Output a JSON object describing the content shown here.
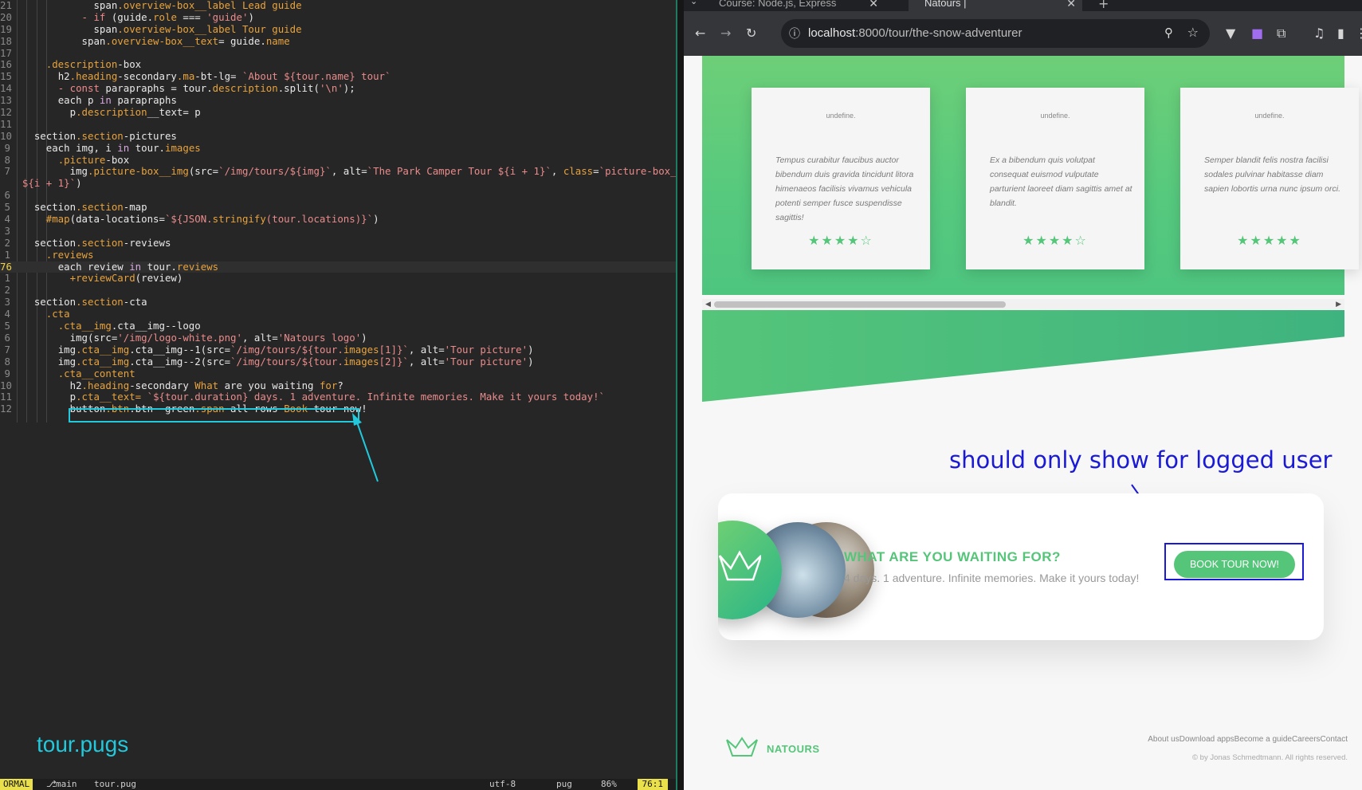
{
  "editor": {
    "lines": [
      {
        "ln": "21",
        "segs": [
          {
            "t": "            "
          },
          {
            "t": "span",
            "c": "t"
          },
          {
            "t": ".overview-box__label ",
            "c": "c"
          },
          {
            "t": "Lead guide",
            "c": "c"
          }
        ]
      },
      {
        "ln": "20",
        "segs": [
          {
            "t": "          "
          },
          {
            "t": "- if ",
            "c": "kw"
          },
          {
            "t": "(guide.",
            "c": "t"
          },
          {
            "t": "role",
            "c": "c"
          },
          {
            "t": " === ",
            "c": "t"
          },
          {
            "t": "'guide'",
            "c": "s"
          },
          {
            "t": ")",
            "c": "t"
          }
        ]
      },
      {
        "ln": "19",
        "segs": [
          {
            "t": "            "
          },
          {
            "t": "span",
            "c": "t"
          },
          {
            "t": ".overview-box__label ",
            "c": "c"
          },
          {
            "t": "Tour guide",
            "c": "c"
          }
        ]
      },
      {
        "ln": "18",
        "segs": [
          {
            "t": "          "
          },
          {
            "t": "span",
            "c": "t"
          },
          {
            "t": ".overview-box__text",
            "c": "c"
          },
          {
            "t": "= guide.",
            "c": "t"
          },
          {
            "t": "name",
            "c": "c"
          }
        ]
      },
      {
        "ln": "17",
        "segs": [
          {
            "t": ""
          }
        ]
      },
      {
        "ln": "16",
        "segs": [
          {
            "t": "    "
          },
          {
            "t": ".description",
            "c": "c"
          },
          {
            "t": "-box",
            "c": "t"
          }
        ]
      },
      {
        "ln": "15",
        "segs": [
          {
            "t": "      "
          },
          {
            "t": "h2",
            "c": "t"
          },
          {
            "t": ".heading",
            "c": "c"
          },
          {
            "t": "-secondary",
            "c": "t"
          },
          {
            "t": ".ma",
            "c": "c"
          },
          {
            "t": "-bt-lg= ",
            "c": "t"
          },
          {
            "t": "`About ${tour.name} tour`",
            "c": "s"
          }
        ]
      },
      {
        "ln": "14",
        "segs": [
          {
            "t": "      "
          },
          {
            "t": "- const ",
            "c": "kw"
          },
          {
            "t": "parapraphs = tour.",
            "c": "t"
          },
          {
            "t": "description",
            "c": "c"
          },
          {
            "t": ".split(",
            "c": "t"
          },
          {
            "t": "'\\n'",
            "c": "s"
          },
          {
            "t": ");",
            "c": "t"
          }
        ]
      },
      {
        "ln": "13",
        "segs": [
          {
            "t": "      "
          },
          {
            "t": "each ",
            "c": "t"
          },
          {
            "t": "p ",
            "c": "t"
          },
          {
            "t": "in ",
            "c": "k"
          },
          {
            "t": "parapraphs",
            "c": "t"
          }
        ]
      },
      {
        "ln": "12",
        "segs": [
          {
            "t": "        "
          },
          {
            "t": "p",
            "c": "t"
          },
          {
            "t": ".description",
            "c": "c"
          },
          {
            "t": "__text= p",
            "c": "t"
          }
        ]
      },
      {
        "ln": "11",
        "segs": [
          {
            "t": ""
          }
        ]
      },
      {
        "ln": "10",
        "segs": [
          {
            "t": "  "
          },
          {
            "t": "section",
            "c": "t"
          },
          {
            "t": ".section",
            "c": "c"
          },
          {
            "t": "-pictures",
            "c": "t"
          }
        ]
      },
      {
        "ln": "9",
        "segs": [
          {
            "t": "    "
          },
          {
            "t": "each ",
            "c": "t"
          },
          {
            "t": "img, i ",
            "c": "t"
          },
          {
            "t": "in ",
            "c": "k"
          },
          {
            "t": "tour.",
            "c": "t"
          },
          {
            "t": "images",
            "c": "c"
          }
        ]
      },
      {
        "ln": "8",
        "segs": [
          {
            "t": "      "
          },
          {
            "t": ".picture",
            "c": "c"
          },
          {
            "t": "-box",
            "c": "t"
          }
        ]
      },
      {
        "ln": "7",
        "segs": [
          {
            "t": "        "
          },
          {
            "t": "img",
            "c": "t"
          },
          {
            "t": ".picture-box__img",
            "c": "c"
          },
          {
            "t": "(src=",
            "c": "t"
          },
          {
            "t": "`/img/tours/${img}`",
            "c": "s"
          },
          {
            "t": ", alt=",
            "c": "t"
          },
          {
            "t": "`The Park Camper Tour ${i + 1}`",
            "c": "s"
          },
          {
            "t": ", ",
            "c": "t"
          },
          {
            "t": "class",
            "c": "a"
          },
          {
            "t": "=",
            "c": "t"
          },
          {
            "t": "`picture-box__img--",
            "c": "s"
          }
        ]
      },
      {
        "ln": "",
        "segs": [
          {
            "t": "${i + 1}`",
            "c": "s"
          },
          {
            "t": ")",
            "c": "t"
          }
        ]
      },
      {
        "ln": "6",
        "segs": [
          {
            "t": ""
          }
        ]
      },
      {
        "ln": "5",
        "segs": [
          {
            "t": "  "
          },
          {
            "t": "section",
            "c": "t"
          },
          {
            "t": ".section",
            "c": "c"
          },
          {
            "t": "-map",
            "c": "t"
          }
        ]
      },
      {
        "ln": "4",
        "segs": [
          {
            "t": "    "
          },
          {
            "t": "#map",
            "c": "c"
          },
          {
            "t": "(data-locations=",
            "c": "t"
          },
          {
            "t": "`${JSON.",
            "c": "s"
          },
          {
            "t": "stringify",
            "c": "c"
          },
          {
            "t": "(tour.locations)}`",
            "c": "s"
          },
          {
            "t": ")",
            "c": "t"
          }
        ]
      },
      {
        "ln": "3",
        "segs": [
          {
            "t": ""
          }
        ]
      },
      {
        "ln": "2",
        "segs": [
          {
            "t": "  "
          },
          {
            "t": "section",
            "c": "t"
          },
          {
            "t": ".section",
            "c": "c"
          },
          {
            "t": "-reviews",
            "c": "t"
          }
        ]
      },
      {
        "ln": "1",
        "segs": [
          {
            "t": "    "
          },
          {
            "t": ".reviews",
            "c": "c"
          }
        ]
      },
      {
        "ln": "76",
        "cur": true,
        "segs": [
          {
            "t": "      "
          },
          {
            "t": "each ",
            "c": "t"
          },
          {
            "t": "review ",
            "c": "t"
          },
          {
            "t": "in ",
            "c": "k"
          },
          {
            "t": "tour.",
            "c": "t"
          },
          {
            "t": "reviews",
            "c": "c"
          }
        ]
      },
      {
        "ln": "1",
        "segs": [
          {
            "t": "        "
          },
          {
            "t": "+reviewCard",
            "c": "c"
          },
          {
            "t": "(review)",
            "c": "t"
          }
        ]
      },
      {
        "ln": "2",
        "segs": [
          {
            "t": ""
          }
        ]
      },
      {
        "ln": "3",
        "segs": [
          {
            "t": "  "
          },
          {
            "t": "section",
            "c": "t"
          },
          {
            "t": ".section",
            "c": "c"
          },
          {
            "t": "-cta",
            "c": "t"
          }
        ]
      },
      {
        "ln": "4",
        "segs": [
          {
            "t": "    "
          },
          {
            "t": ".cta",
            "c": "c"
          }
        ]
      },
      {
        "ln": "5",
        "segs": [
          {
            "t": "      "
          },
          {
            "t": ".cta__img",
            "c": "c"
          },
          {
            "t": ".cta__img--logo",
            "c": "t"
          }
        ]
      },
      {
        "ln": "6",
        "segs": [
          {
            "t": "        "
          },
          {
            "t": "img",
            "c": "t"
          },
          {
            "t": "(src=",
            "c": "t"
          },
          {
            "t": "'/img/logo-white.png'",
            "c": "s"
          },
          {
            "t": ", alt=",
            "c": "t"
          },
          {
            "t": "'Natours logo'",
            "c": "s"
          },
          {
            "t": ")",
            "c": "t"
          }
        ]
      },
      {
        "ln": "7",
        "segs": [
          {
            "t": "      "
          },
          {
            "t": "img",
            "c": "t"
          },
          {
            "t": ".cta__img",
            "c": "c"
          },
          {
            "t": ".cta__img--1",
            "c": "t"
          },
          {
            "t": "(src=",
            "c": "t"
          },
          {
            "t": "`/img/tours/${tour.",
            "c": "s"
          },
          {
            "t": "images",
            "c": "c"
          },
          {
            "t": "[1]}`",
            "c": "s"
          },
          {
            "t": ", alt=",
            "c": "t"
          },
          {
            "t": "'Tour picture'",
            "c": "s"
          },
          {
            "t": ")",
            "c": "t"
          }
        ]
      },
      {
        "ln": "8",
        "segs": [
          {
            "t": "      "
          },
          {
            "t": "img",
            "c": "t"
          },
          {
            "t": ".cta__img",
            "c": "c"
          },
          {
            "t": ".cta__img--2",
            "c": "t"
          },
          {
            "t": "(src=",
            "c": "t"
          },
          {
            "t": "`/img/tours/${tour.",
            "c": "s"
          },
          {
            "t": "images",
            "c": "c"
          },
          {
            "t": "[2]}`",
            "c": "s"
          },
          {
            "t": ", alt=",
            "c": "t"
          },
          {
            "t": "'Tour picture'",
            "c": "s"
          },
          {
            "t": ")",
            "c": "t"
          }
        ]
      },
      {
        "ln": "9",
        "segs": [
          {
            "t": "      "
          },
          {
            "t": ".cta__content",
            "c": "c"
          }
        ]
      },
      {
        "ln": "10",
        "segs": [
          {
            "t": "        "
          },
          {
            "t": "h2",
            "c": "t"
          },
          {
            "t": ".heading",
            "c": "c"
          },
          {
            "t": "-secondary ",
            "c": "t"
          },
          {
            "t": "What ",
            "c": "c"
          },
          {
            "t": "are you waiting ",
            "c": "t"
          },
          {
            "t": "for",
            "c": "c"
          },
          {
            "t": "?",
            "c": "t"
          }
        ]
      },
      {
        "ln": "11",
        "segs": [
          {
            "t": "        "
          },
          {
            "t": "p",
            "c": "t"
          },
          {
            "t": ".cta__text= ",
            "c": "c"
          },
          {
            "t": "`${tour.duration} days. 1 adventure. Infinite memories. Make it yours today!`",
            "c": "s"
          }
        ]
      },
      {
        "ln": "12",
        "segs": [
          {
            "t": "        "
          },
          {
            "t": "button",
            "c": "t"
          },
          {
            "t": ".btn",
            "c": "c"
          },
          {
            "t": ".btn--green",
            "c": "t"
          },
          {
            "t": ".span",
            "c": "c"
          },
          {
            "t": "-all-rows ",
            "c": "t"
          },
          {
            "t": "Book ",
            "c": "c"
          },
          {
            "t": "tour now!",
            "c": "t"
          }
        ]
      }
    ],
    "file_label": "tour.pugs",
    "status": {
      "mode": "ORMAL",
      "branch": "main",
      "file": "tour.pug",
      "encoding": "utf-8",
      "filetype": "pug",
      "percent": "86%",
      "position": "76:1"
    }
  },
  "browser": {
    "tabs": [
      {
        "title": "Course: Node.js, Express"
      },
      {
        "title": "Natours |"
      }
    ],
    "url_host": "localhost",
    "url_path": ":8000/tour/the-snow-adventurer",
    "reviews": [
      {
        "img_alt": "undefine.",
        "text": "Tempus curabitur faucibus auctor bibendum duis gravida tincidunt litora himenaeos facilisis vivamus vehicula potenti semper fusce suspendisse sagittis!",
        "stars": "★★★★☆"
      },
      {
        "img_alt": "undefine.",
        "text": "Ex a bibendum quis volutpat consequat euismod vulputate parturient laoreet diam sagittis amet at blandit.",
        "stars": "★★★★☆"
      },
      {
        "img_alt": "undefine.",
        "text": "Semper blandit felis nostra facilisi sodales pulvinar habitasse diam sapien lobortis urna nunc ipsum orci.",
        "stars": "★★★★★"
      }
    ],
    "annotation": "should only show for logged user",
    "cta": {
      "title": "WHAT ARE YOU WAITING FOR?",
      "text": "4 days. 1 adventure. Infinite memories. Make it yours today!",
      "button": "BOOK TOUR NOW!"
    },
    "footer": {
      "brand": "NATOURS",
      "links": [
        "About us",
        "Download apps",
        "Become a guide",
        "Careers",
        "Contact"
      ],
      "copyright": "© by Jonas Schmedtmann. All rights reserved."
    }
  },
  "colors": {
    "brand_green": "#55c57a",
    "annotation_blue": "#1a1ad6",
    "annotation_cyan": "#22c8dc"
  }
}
